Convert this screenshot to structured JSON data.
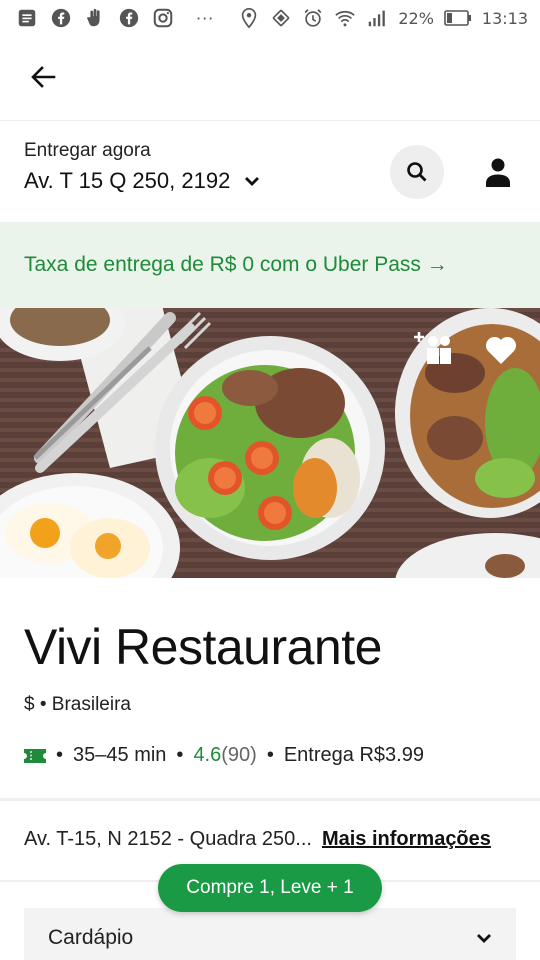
{
  "status_bar": {
    "battery": "22%",
    "time": "13:13",
    "more": "···"
  },
  "header": {
    "deliver_label": "Entregar agora",
    "address": "Av. T 15 Q 250, 2192"
  },
  "promo": {
    "text": "Taxa de entrega de R$ 0 com o Uber Pass →"
  },
  "restaurant": {
    "name": "Vivi Restaurante",
    "price": "$",
    "cuisine": "Brasileira",
    "eta": "35–45 min",
    "rating": "4.6",
    "reviews": "(90)",
    "delivery_fee": "Entrega R$3.99",
    "address": "Av. T-15, N 2152 - Quadra 250...",
    "more_info": "Mais informações"
  },
  "promo_pill": "Compre 1, Leve + 1",
  "menu": {
    "label": "Cardápio"
  },
  "colors": {
    "accent_green": "#1f8a3a",
    "pill_green": "#1b9a45",
    "promo_bg": "#eaf4ea"
  }
}
